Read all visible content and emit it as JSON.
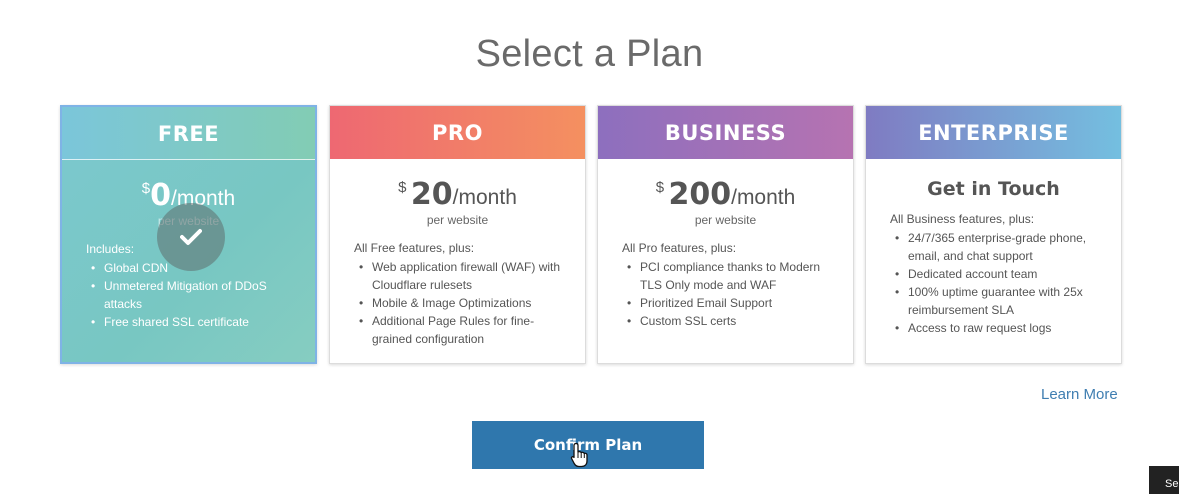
{
  "page": {
    "title": "Select a Plan"
  },
  "plans": [
    {
      "name": "FREE",
      "currency": "$",
      "amount": "0",
      "period": "/month",
      "per": "per website",
      "intro": "Includes:",
      "features": [
        "Global CDN",
        "Unmetered Mitigation of DDoS attacks",
        "Free shared SSL certificate"
      ],
      "selected": true
    },
    {
      "name": "PRO",
      "currency": "$",
      "amount": "20",
      "period": "/month",
      "per": "per website",
      "intro": "All Free features, plus:",
      "features": [
        "Web application firewall (WAF) with Cloudflare rulesets",
        "Mobile & Image Optimizations",
        "Additional Page Rules for fine-grained configuration"
      ]
    },
    {
      "name": "BUSINESS",
      "currency": "$",
      "amount": "200",
      "period": "/month",
      "per": "per website",
      "intro": "All Pro features, plus:",
      "features": [
        "PCI compliance thanks to Modern TLS Only mode and WAF",
        "Prioritized Email Support",
        "Custom SSL certs"
      ]
    },
    {
      "name": "ENTERPRISE",
      "headline": "Get in Touch",
      "intro": "All Business features, plus:",
      "features": [
        "24/7/365 enterprise-grade phone, email, and chat support",
        "Dedicated account team",
        "100% uptime guarantee with 25x reimbursement SLA",
        "Access to raw request logs"
      ]
    }
  ],
  "actions": {
    "learn_more": "Learn More",
    "confirm": "Confirm Plan"
  },
  "corner_tab": {
    "label": "Se"
  },
  "colors": {
    "confirm_button": "#2f77ad",
    "link": "#3f7eb1",
    "free_header": "#7bc6da",
    "pro_header": "#ee6872",
    "business_header": "#8d6fbe",
    "enterprise_header": "#74bfe0"
  },
  "icons": {
    "selected": "check-icon",
    "cursor": "hand-pointer-icon"
  }
}
